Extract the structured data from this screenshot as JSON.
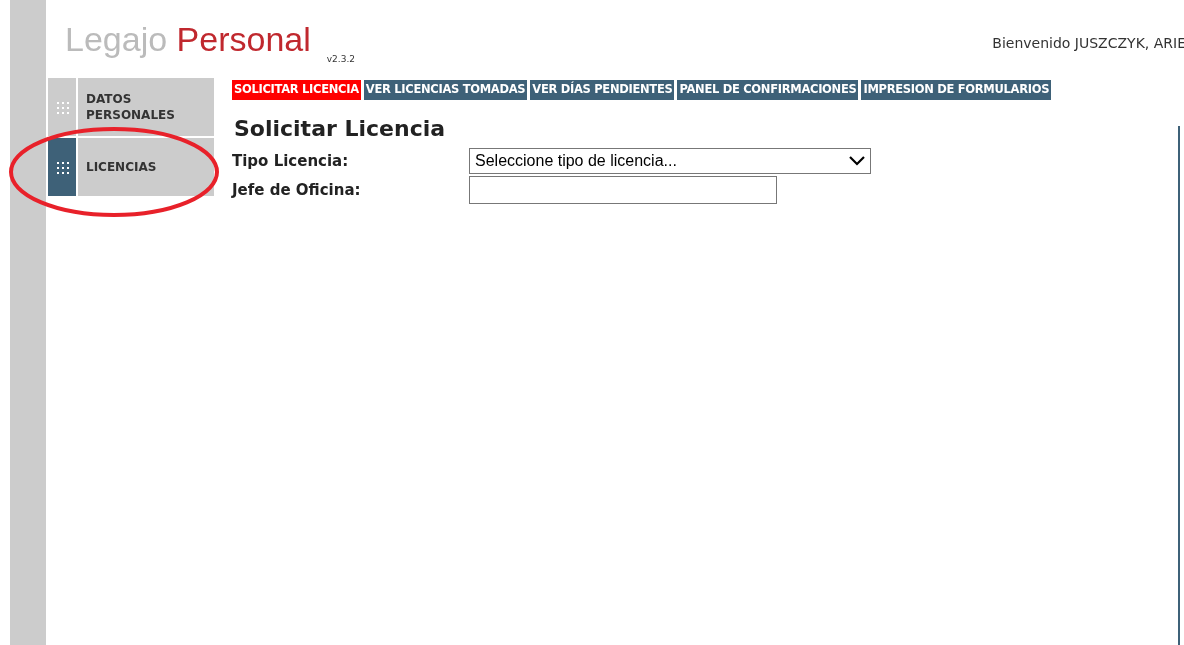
{
  "header": {
    "logo_light": "Legajo",
    "logo_accent": "Personal",
    "version": "v2.3.2",
    "welcome": "Bienvenido JUSZCZYK, ARIE"
  },
  "sidebar": {
    "items": [
      {
        "label": "DATOS PERSONALES",
        "selected": false
      },
      {
        "label": "LICENCIAS",
        "selected": true
      }
    ]
  },
  "tabs": [
    {
      "label": "SOLICITAR LICENCIA",
      "selected": true
    },
    {
      "label": "VER LICENCIAS TOMADAS",
      "selected": false
    },
    {
      "label": "VER DÍAS PENDIENTES",
      "selected": false
    },
    {
      "label": "PANEL DE CONFIRMACIONES",
      "selected": false
    },
    {
      "label": "IMPRESION DE FORMULARIOS",
      "selected": false
    }
  ],
  "form": {
    "title": "Solicitar Licencia",
    "fields": [
      {
        "kind": "select",
        "label": "Tipo Licencia:",
        "value": "Seleccione tipo de licencia..."
      },
      {
        "kind": "text",
        "label": "Jefe de Oficina:"
      }
    ]
  },
  "annotation": {
    "kind": "ellipse"
  }
}
